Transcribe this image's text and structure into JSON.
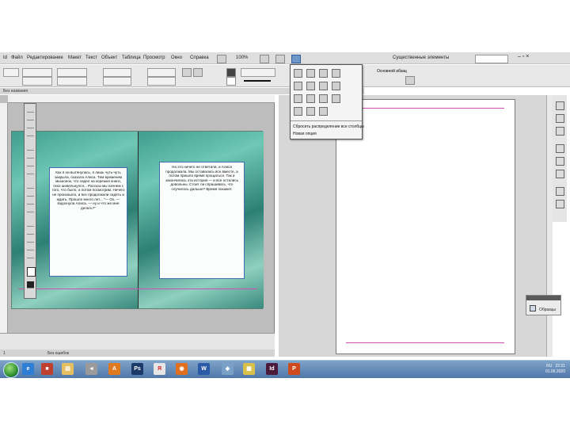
{
  "menubar": {
    "items": [
      "Файл",
      "Редактирование",
      "Макет",
      "Текст",
      "Объект",
      "Таблица",
      "Просмотр",
      "Окно",
      "Справка"
    ],
    "zoom": "100%",
    "workspace": "Существенные элементы",
    "search_placeholder": ""
  },
  "control_panel": {
    "style_label": "Основной абзац"
  },
  "left_page_text": "Как я ни вытянулась, я лишь чуть-чуть закрыла, сказала Алиса. Тем временем мышонок, что сидел на корешке книги, тихо шевельнулся... Рассказ мы начнем с того, что было, а потом посмотрим. Ничего не произошло, и все продолжали сидеть и ждать. Прошло много лет... \"— Ох, — вздохнула Алиса, — ну и что же мне делать?\"",
  "right_page_text": "На это ничего не ответили, и Алиса продолжала. Мы оставались все вместе, а потом пришло время прощаться. Так и закончилась эта история — и все остались довольны. Стоит ли спрашивать, что случилось дальше? Время покажет.",
  "dropdown": {
    "tooltip_line1": "Сбросить распределение все столбцы",
    "tooltip_line2": "Новая опция"
  },
  "tab_label": "Без названия",
  "statusbar": {
    "page": "1",
    "errors": "Без ошибок"
  },
  "minipanel": {
    "label": "Образцы"
  },
  "taskbar": {
    "apps": [
      "ie",
      "folder",
      "media",
      "winamp",
      "acrobat",
      "photoshop",
      "yandex",
      "firefox",
      "word",
      "explorer",
      "indesign",
      "powerpoint"
    ],
    "time": "22:31",
    "date": "01.06.2020",
    "lang": "RU"
  },
  "colors": {
    "accent": "#3d6fb0",
    "margin": "#d24fb2",
    "page_bg": "#3f9e8e",
    "taskbar": "#4f77a8"
  }
}
